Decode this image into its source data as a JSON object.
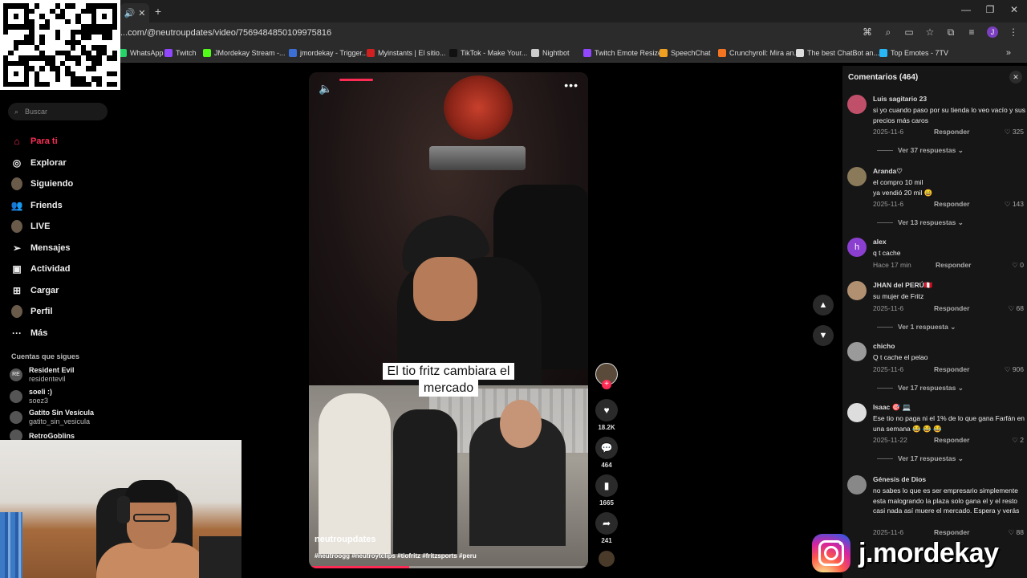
{
  "browser": {
    "url": "...com/@neutroupdates/video/7569484850109975816",
    "bookmarks": [
      {
        "label": "WhatsApp",
        "color": "#25d366"
      },
      {
        "label": "Twitch",
        "color": "#9146ff"
      },
      {
        "label": "JMordekay Stream -...",
        "color": "#53fc18"
      },
      {
        "label": "jmordekay - Trigger...",
        "color": "#3b6fd6"
      },
      {
        "label": "Myinstants | El sitio...",
        "color": "#d02020"
      },
      {
        "label": "TikTok - Make Your...",
        "color": "#111111"
      },
      {
        "label": "Nightbot",
        "color": "#cccccc"
      },
      {
        "label": "Twitch Emote Resize...",
        "color": "#9146ff"
      },
      {
        "label": "SpeechChat",
        "color": "#f0a020"
      },
      {
        "label": "Crunchyroll: Mira an...",
        "color": "#f47521"
      },
      {
        "label": "The best ChatBot an...",
        "color": "#dddddd"
      },
      {
        "label": "Top Emotes - 7TV",
        "color": "#29b6f6"
      }
    ]
  },
  "sidebar": {
    "search_placeholder": "Buscar",
    "nav": [
      {
        "label": "Para ti",
        "icon": "home-icon"
      },
      {
        "label": "Explorar",
        "icon": "compass-icon"
      },
      {
        "label": "Siguiendo",
        "icon": "following-avatar"
      },
      {
        "label": "Friends",
        "icon": "friends-icon"
      },
      {
        "label": "LIVE",
        "icon": "live-avatar"
      },
      {
        "label": "Mensajes",
        "icon": "send-icon"
      },
      {
        "label": "Actividad",
        "icon": "activity-icon"
      },
      {
        "label": "Cargar",
        "icon": "upload-icon"
      },
      {
        "label": "Perfil",
        "icon": "profile-avatar"
      },
      {
        "label": "Más",
        "icon": "more-icon"
      }
    ],
    "following_heading": "Cuentas que sigues",
    "following": [
      {
        "name": "Resident Evil",
        "handle": "residentevil",
        "avatar_text": "RE"
      },
      {
        "name": "soeli :)",
        "handle": "soez3",
        "avatar_text": ""
      },
      {
        "name": "Gatito Sin Vesícula",
        "handle": "gatito_sin_vesicula",
        "avatar_text": ""
      },
      {
        "name": "RetroGoblins",
        "handle": "",
        "avatar_text": ""
      }
    ]
  },
  "video": {
    "caption_line1": "El tio fritz cambiara el",
    "caption_line2": "mercado",
    "author": "neutroupdates",
    "hashtags": "#neutroogg #neutroytclips #tiofritz #fritzsports #peru",
    "progress": 0.36,
    "mute_icon": "volume-icon",
    "more_icon": "more-horizontal-icon"
  },
  "actions": {
    "likes": "18.2K",
    "comments": "464",
    "saves": "1665",
    "shares": "241"
  },
  "comments": {
    "title": "Comentarios (464)",
    "reply_label": "Responder",
    "items": [
      {
        "name": "Luis sagitario 23",
        "text": "si yo cuando paso por su tienda lo veo vacío y sus precios más caros",
        "date": "2025-11-6",
        "likes": "325",
        "more": "Ver 37 respuestas",
        "avatar": ""
      },
      {
        "name": "Aranda♡",
        "text": "el compro 10 mil\nya vendió 20 mil 😄",
        "date": "2025-11-6",
        "likes": "143",
        "more": "Ver 13 respuestas",
        "avatar": ""
      },
      {
        "name": "alex",
        "text": "q t cache",
        "date": "Hace 17 min",
        "likes": "0",
        "more": "",
        "avatar": "h"
      },
      {
        "name": "JHAN del PERÚ🇵🇪",
        "text": "su mujer de Fritz",
        "date": "2025-11-6",
        "likes": "68",
        "more": "Ver 1 respuesta",
        "avatar": ""
      },
      {
        "name": "chicho",
        "text": "Q t cache el pelao",
        "date": "2025-11-6",
        "likes": "906",
        "more": "Ver 17 respuestas",
        "avatar": ""
      },
      {
        "name": "Isaac 🎯 💻",
        "text": "Ese tio no paga ni el 1% de lo que gana Farfán en una semana 😂 😂 😂",
        "date": "2025-11-22",
        "likes": "2",
        "more": "Ver 17 respuestas",
        "avatar": ""
      },
      {
        "name": "Génesis de Dios",
        "text": "no sabes lo que es ser empresario simplemente esta malogrando la plaza solo gana el y el resto casi nada así muere el mercado. Espera y verás",
        "date": "2025-11-6",
        "likes": "88",
        "more": "",
        "avatar": ""
      }
    ]
  },
  "watermark": {
    "handle": "j.mordekay"
  }
}
